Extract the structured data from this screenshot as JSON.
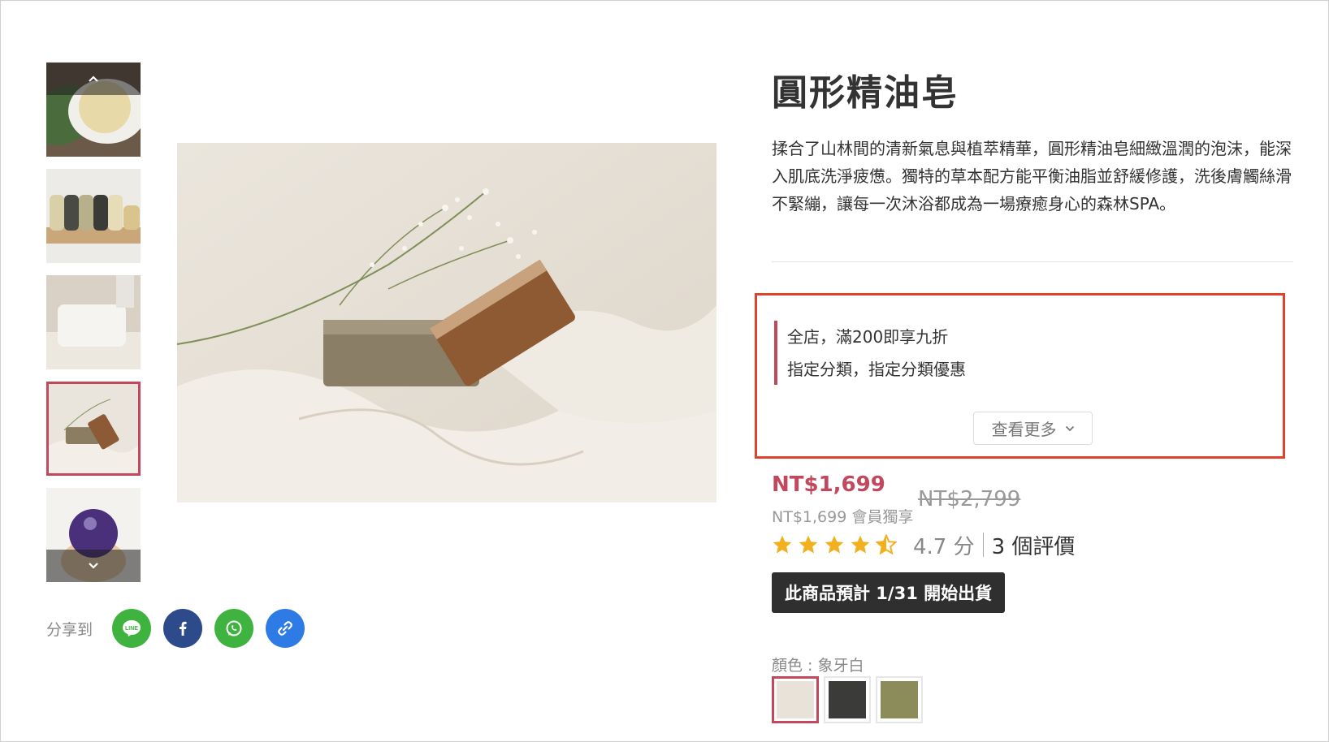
{
  "product": {
    "title": "圓形精油皂",
    "description": "揉合了山林間的清新氣息與植萃精華，圓形精油皂細緻溫潤的泡沫，能深入肌底洗淨疲憊。獨特的草本配方能平衡油脂並舒緩修護，洗後膚觸絲滑不緊繃，讓每一次沐浴都成為一場療癒身心的森林SPA。"
  },
  "promotions": {
    "items": [
      "全店，滿200即享九折",
      "指定分類，指定分類優惠"
    ],
    "more_label": "查看更多"
  },
  "pricing": {
    "sale_price": "NT$1,699",
    "original_price": "NT$2,799",
    "member_price": "NT$1,699 會員獨享"
  },
  "rating": {
    "stars": 4.5,
    "score_text": "4.7 分",
    "reviews_text": "3 個評價"
  },
  "shipping_notice": "此商品預計 1/31 開始出貨",
  "variants": {
    "label": "顏色 : 象牙白",
    "swatches": [
      {
        "name": "象牙白",
        "color": "#e9e2d9",
        "selected": true
      },
      {
        "name": "dark",
        "color": "#3b3b39",
        "selected": false
      },
      {
        "name": "olive",
        "color": "#8b8c59",
        "selected": false
      }
    ]
  },
  "share": {
    "label": "分享到",
    "buttons": [
      {
        "icon": "line-icon",
        "color": "#3fb33f"
      },
      {
        "icon": "facebook-icon",
        "color": "#2d4a8a"
      },
      {
        "icon": "whatsapp-icon",
        "color": "#3fb33f"
      },
      {
        "icon": "link-icon",
        "color": "#2f7be5"
      }
    ]
  },
  "gallery": {
    "thumbnails": [
      "soap-on-dish",
      "soap-row-on-tray",
      "white-soap-bar",
      "soaps-with-flowers",
      "round-purple-soap"
    ],
    "selected_index": 3,
    "icons": {
      "prev": "chevron-up-icon",
      "next": "chevron-down-icon"
    }
  },
  "colors": {
    "accent": "#c2485e",
    "highlight": "#e0432b",
    "star": "#f2b01e"
  }
}
